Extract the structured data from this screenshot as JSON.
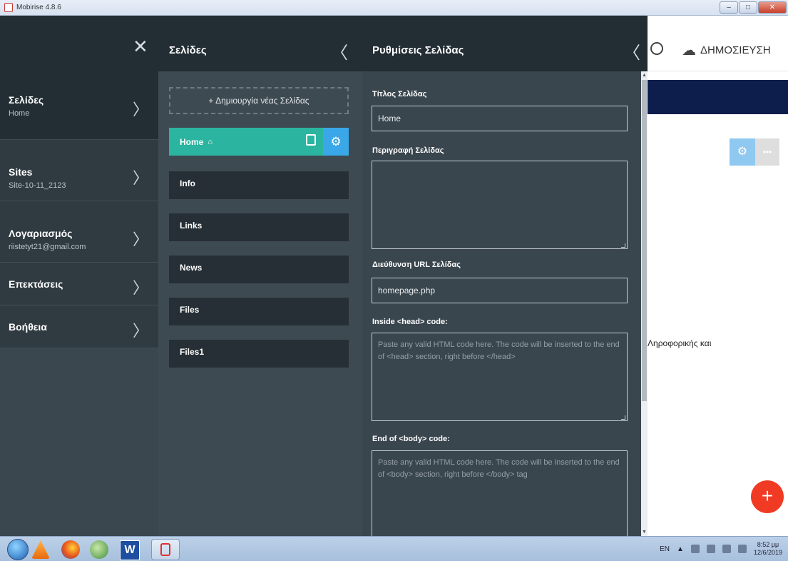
{
  "window": {
    "title": "Mobirise 4.8.6",
    "buttons": {
      "minimize": "–",
      "maximize": "□",
      "close": "✕"
    }
  },
  "menu": {
    "close_icon": "✕",
    "items": [
      {
        "label": "Σελίδες",
        "sub": "Home"
      },
      {
        "label": "Sites",
        "sub": "Site-10-11_2123"
      },
      {
        "label": "Λογαριασμός",
        "sub": "riistetyt21@gmail.com"
      },
      {
        "label": "Επεκτάσεις",
        "sub": ""
      },
      {
        "label": "Βοήθεια",
        "sub": ""
      }
    ],
    "chevron": "〉"
  },
  "pages": {
    "title": "Σελίδες",
    "back": "〈",
    "new_page": "+ Δημιουργία νέας Σελίδας",
    "list": [
      "Home",
      "Info",
      "Links",
      "News",
      "Files",
      "Files1"
    ]
  },
  "settings": {
    "title": "Ρυθμίσεις Σελίδας",
    "back": "〈",
    "page_title_label": "Τίτλος Σελίδας",
    "page_title_value": "Home",
    "description_label": "Περιγραφή Σελίδας",
    "description_value": "",
    "url_label": "Διεύθυνση URL Σελίδας",
    "url_value": "homepage.php",
    "head_label": "Inside <head> code:",
    "head_placeholder": "Paste any valid HTML code here. The code will be inserted to the end of <head> section, right before </head>",
    "body_label": "End of <body> code:",
    "body_placeholder": "Paste any valid HTML code here. The code will be inserted to the end of <body> section, right before </body> tag"
  },
  "canvas": {
    "publish": "ΔΗΜΟΣΙΕΥΣΗ",
    "text": "Ληροφορικής και",
    "fab": "+"
  },
  "taskbar": {
    "word": "W",
    "lang": "EN",
    "time": "8:52 μμ",
    "date": "12/6/2019"
  }
}
